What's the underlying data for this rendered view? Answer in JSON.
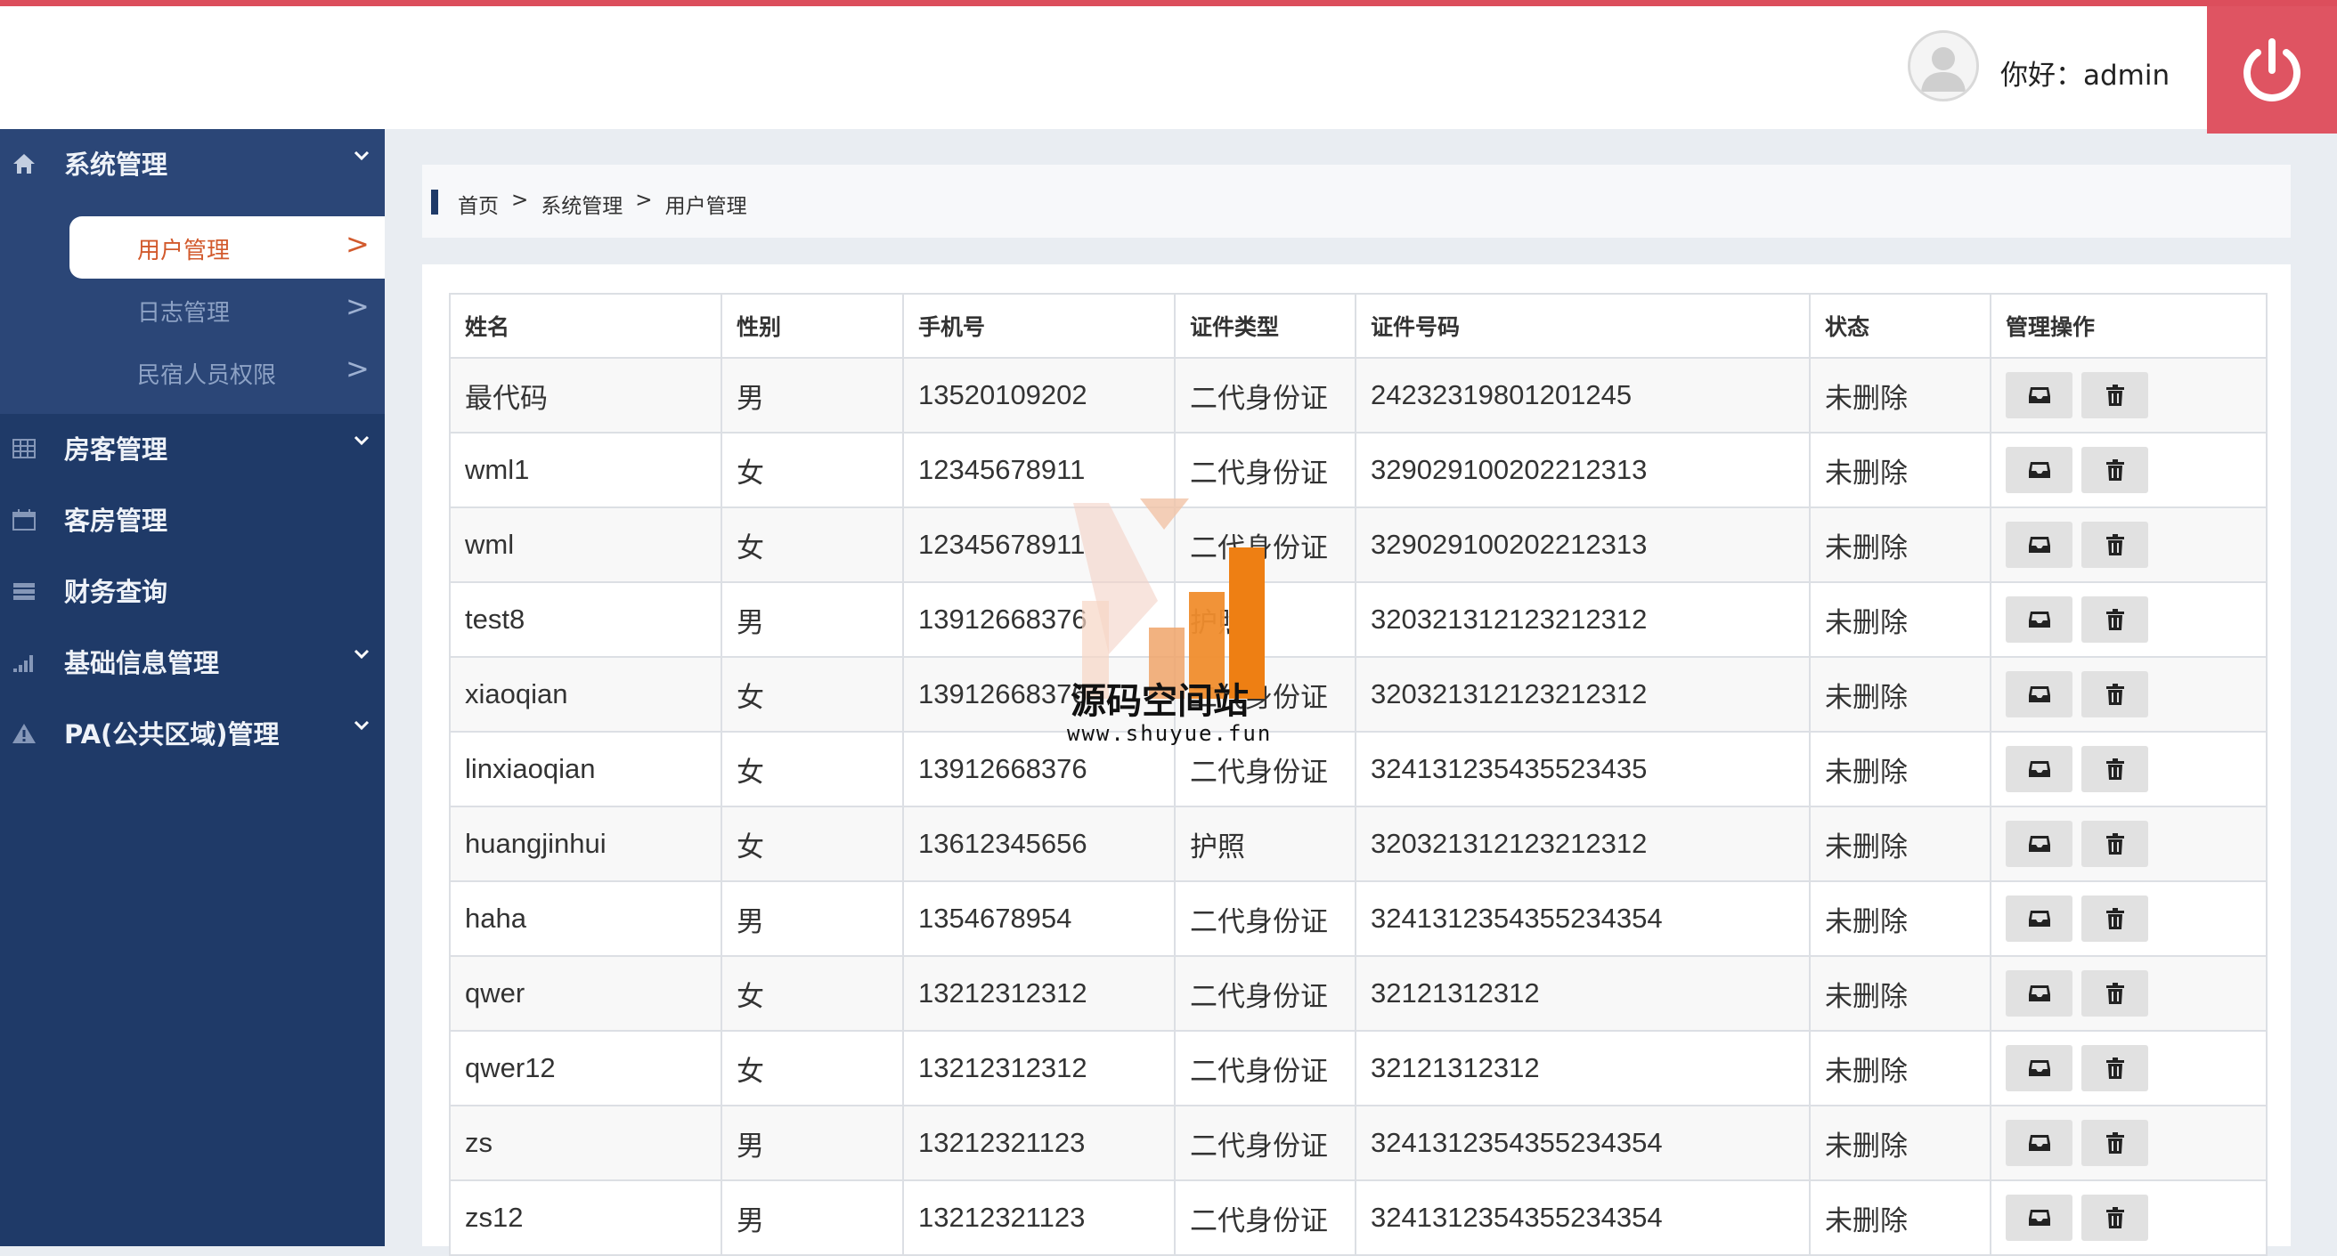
{
  "header": {
    "greeting": "你好：admin",
    "power_icon": "power-icon",
    "avatar_icon": "user-avatar-icon",
    "accent_color": "#dc4e5c"
  },
  "sidebar": {
    "groups": [
      {
        "label": "系统管理",
        "icon": "home-icon",
        "expanded": true,
        "items": [
          {
            "label": "用户管理",
            "arrow": ">",
            "active": true
          },
          {
            "label": "日志管理",
            "arrow": ">"
          },
          {
            "label": "民宿人员权限",
            "arrow": ">"
          }
        ]
      },
      {
        "label": "房客管理",
        "icon": "table-icon"
      },
      {
        "label": "客房管理",
        "icon": "calendar-icon"
      },
      {
        "label": "财务查询",
        "icon": "list-icon"
      },
      {
        "label": "基础信息管理",
        "icon": "signal-bars-icon"
      },
      {
        "label": "PA(公共区域)管理",
        "icon": "warning-icon"
      }
    ],
    "bg_color": "#1f3a68"
  },
  "breadcrumb": [
    "首页",
    ">",
    "系统管理",
    ">",
    "用户管理"
  ],
  "table": {
    "headers": [
      "姓名",
      "性别",
      "手机号",
      "证件类型",
      "证件号码",
      "状态",
      "管理操作"
    ],
    "rows": [
      [
        "最代码",
        "男",
        "13520109202",
        "二代身份证",
        "24232319801201245",
        "未删除"
      ],
      [
        "wml1",
        "女",
        "12345678911",
        "二代身份证",
        "329029100202212313",
        "未删除"
      ],
      [
        "wml",
        "女",
        "12345678911",
        "二代身份证",
        "329029100202212313",
        "未删除"
      ],
      [
        "test8",
        "男",
        "13912668376",
        "护照",
        "320321312123212312",
        "未删除"
      ],
      [
        "xiaoqian",
        "女",
        "13912668376",
        "二代身份证",
        "320321312123212312",
        "未删除"
      ],
      [
        "linxiaoqian",
        "女",
        "13912668376",
        "二代身份证",
        "324131235435523435",
        "未删除"
      ],
      [
        "huangjinhui",
        "女",
        "13612345656",
        "护照",
        "320321312123212312",
        "未删除"
      ],
      [
        "haha",
        "男",
        "1354678954",
        "二代身份证",
        "3241312354355234354",
        "未删除"
      ],
      [
        "qwer",
        "女",
        "13212312312",
        "二代身份证",
        "32121312312",
        "未删除"
      ],
      [
        "qwer12",
        "女",
        "13212312312",
        "二代身份证",
        "32121312312",
        "未删除"
      ],
      [
        "zs",
        "男",
        "13212321123",
        "二代身份证",
        "3241312354355234354",
        "未删除"
      ],
      [
        "zs12",
        "男",
        "13212321123",
        "二代身份证",
        "3241312354355234354",
        "未删除"
      ]
    ],
    "row_actions": [
      {
        "name": "edit",
        "icon": "inbox-icon"
      },
      {
        "name": "delete",
        "icon": "trash-icon"
      }
    ]
  },
  "watermark": {
    "title": "源码空间站",
    "url": "www.shuyue.fun",
    "logo_icon": "bar-chart-logo-icon"
  }
}
